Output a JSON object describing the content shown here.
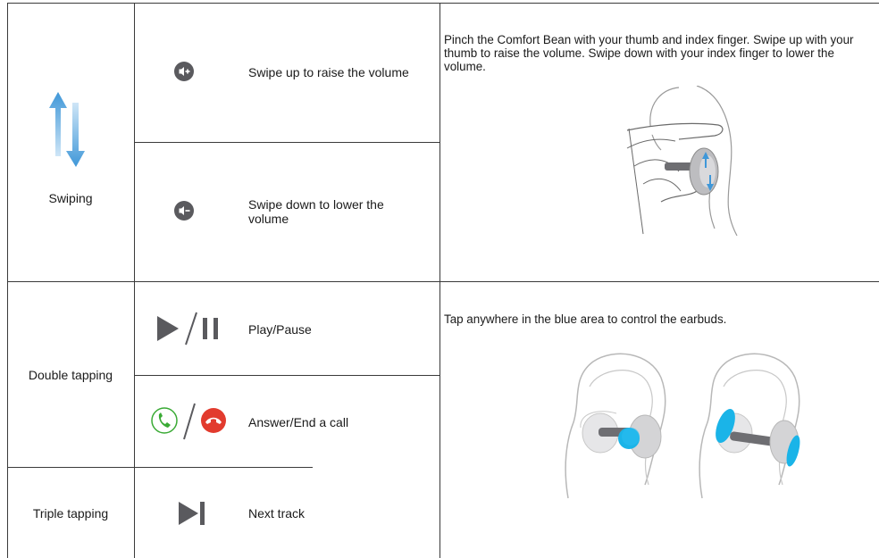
{
  "rows": [
    {
      "gesture": "Swiping",
      "actions": [
        {
          "icon": "volume-up-icon",
          "label": "Swipe up to raise the volume"
        },
        {
          "icon": "volume-down-icon",
          "label": "Swipe down to lower the volume"
        }
      ],
      "description": "Pinch the Comfort Bean with your thumb and index finger. Swipe up with your thumb to raise the volume. Swipe down with your index finger to lower the volume."
    },
    {
      "gesture": "Double tapping",
      "actions": [
        {
          "icon": "play-pause-icon",
          "label": "Play/Pause"
        },
        {
          "icon": "answer-end-call-icon",
          "label": "Answer/End a call"
        }
      ],
      "description": "Tap anywhere in the blue area to control the earbuds."
    },
    {
      "gesture": "Triple tapping",
      "actions": [
        {
          "icon": "next-track-icon",
          "label": "Next track"
        }
      ]
    }
  ],
  "colors": {
    "icon_gray": "#5a5a5e",
    "swipe_blue": "#4aa3df",
    "tap_blue": "#1ab4e8",
    "call_green": "#3aaa35",
    "call_red": "#e23b2e",
    "line": "#3a3a3a"
  }
}
